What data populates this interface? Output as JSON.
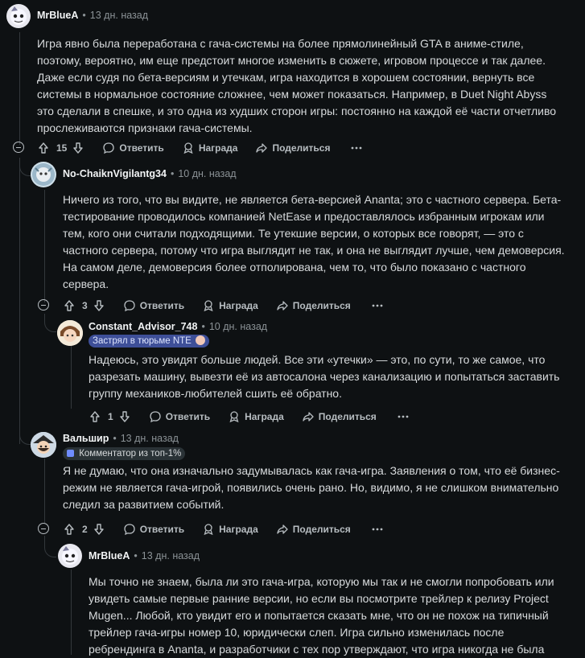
{
  "comments": [
    {
      "author": "MrBlueA",
      "time": "13 дн. назад",
      "body": [
        "Игра явно была переработана с гача-системы на более прямолинейный GTA в аниме-стиле,",
        "поэтому, вероятно, им еще предстоит многое изменить в сюжете, игровом процессе и так далее.",
        "Даже если судя по бета-версиям и утечкам, игра находится в хорошем состоянии, вернуть все",
        "системы в нормальное состояние сложнее, чем может показаться. Например, в Duet Night Abyss",
        "это сделали в спешке, и это одна из худших сторон игры: постоянно на каждой её части отчетливо",
        "прослеживаются признаки гача-системы."
      ],
      "votes": "15"
    },
    {
      "author": "No-ChaiknVigilantg34",
      "time": "10 дн. назад",
      "body": [
        "Ничего из того, что вы видите, не является бета-версией Ananta; это с частного сервера. Бета-",
        "тестирование проводилось компанией NetEase и предоставлялось избранным игрокам или",
        "тем, кого они считали подходящими. Те утекшие версии, о которых все говорят, — это с",
        "частного сервера, потому что игра выглядит не так, и она не выглядит лучше, чем демоверсия.",
        "На самом деле, демоверсия более отполирована, чем то, что было показано с частного",
        "сервера."
      ],
      "votes": "3"
    },
    {
      "author": "Constant_Advisor_748",
      "time": "10 дн. назад",
      "flair": "Застрял в тюрьме NTE",
      "body": [
        "Надеюсь, это увидят больше людей. Все эти «утечки» — это, по сути, то же самое, что",
        "разрезать машину, вывезти её из автосалона через канализацию и попытаться заставить",
        "группу механиков-любителей сшить её обратно."
      ],
      "votes": "1"
    },
    {
      "author": "Вальшир",
      "time": "13 дн. назад",
      "flair": "Комментатор из топ-1%",
      "body": [
        "Я не думаю, что она изначально задумывалась как гача-игра. Заявления о том, что её бизнес-",
        "режим не является гача-игрой, появились очень рано. Но, видимо, я не слишком внимательно",
        "следил за развитием событий."
      ],
      "votes": "2"
    },
    {
      "author": "MrBlueA",
      "time": "13 дн. назад",
      "body": [
        "Мы точно не знаем, была ли это гача-игра, которую мы так и не смогли попробовать или",
        "увидеть самые первые ранние версии, но если вы посмотрите трейлер к релизу Project",
        "Mugen... Любой, кто увидит его и попытается сказать мне, что он не похож на типичный",
        "трейлер гача-игры номер 10, юридически слеп. Игра сильно изменилась после",
        "ребрендинга в Ananta, и разработчики с тех пор утверждают, что игра никогда не была"
      ]
    }
  ],
  "actions": {
    "reply": "Ответить",
    "award": "Награда",
    "share": "Поделиться"
  },
  "separator": "•",
  "colors": {
    "background": "#0e1113",
    "text": "#d7dadc",
    "muted": "#8b9296",
    "flair_blue": "#3e4f98",
    "flair_dark": "#2a3236"
  }
}
